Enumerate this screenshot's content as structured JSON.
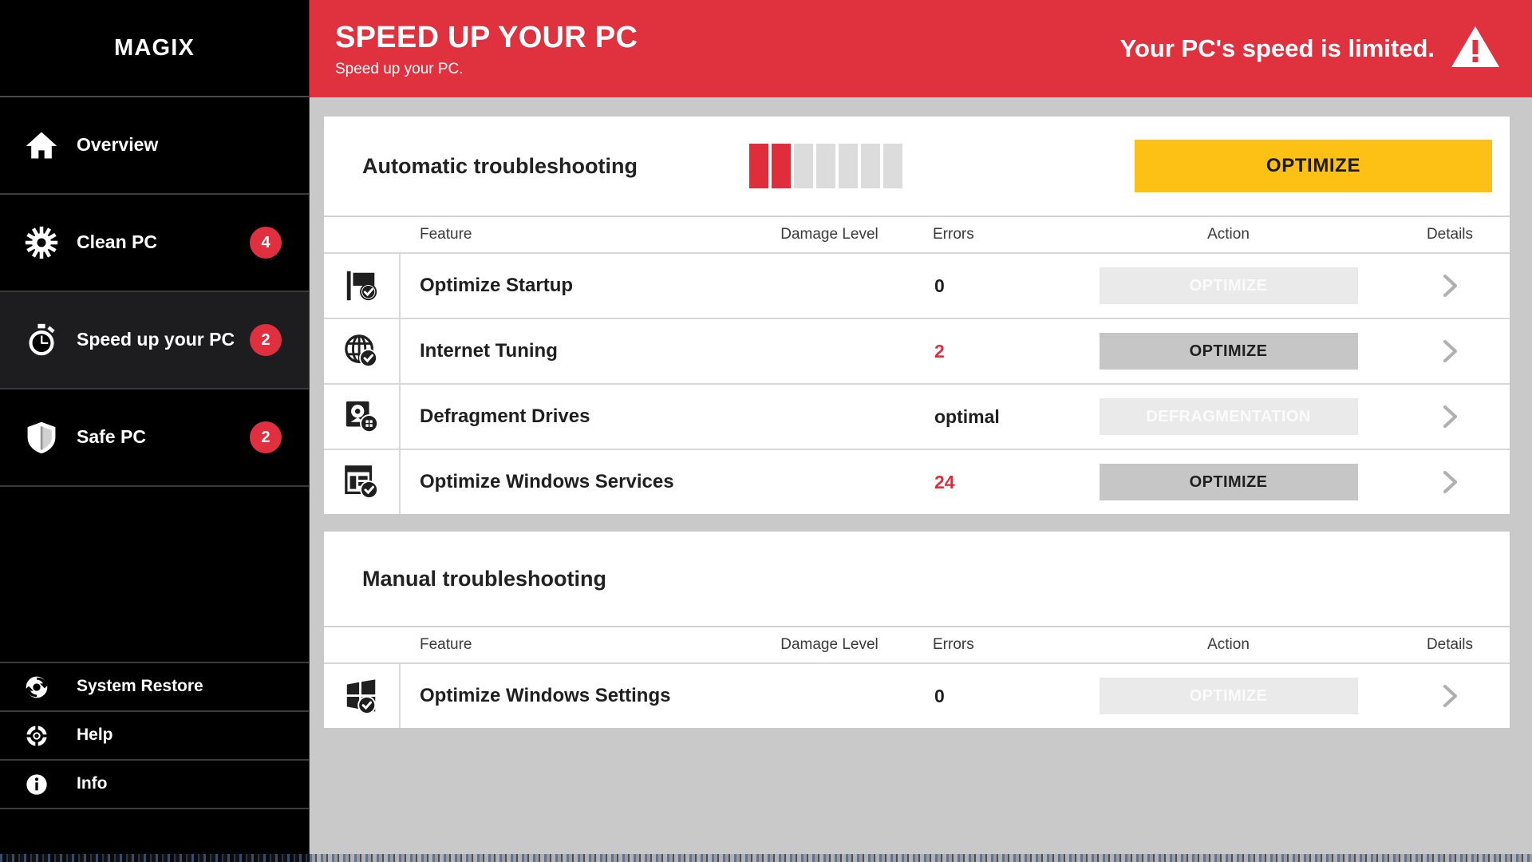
{
  "brand": {
    "name": "MAGIX"
  },
  "sidebar": {
    "main_items": [
      {
        "label": "Overview",
        "icon": "home-icon",
        "badge": null,
        "active": false
      },
      {
        "label": "Clean PC",
        "icon": "gear-icon",
        "badge": "4",
        "active": false
      },
      {
        "label": "Speed up your PC",
        "icon": "stopwatch-icon",
        "badge": "2",
        "active": true
      },
      {
        "label": "Safe PC",
        "icon": "shield-icon",
        "badge": "2",
        "active": false
      }
    ],
    "bottom_items": [
      {
        "label": "System Restore",
        "icon": "restore-icon"
      },
      {
        "label": "Help",
        "icon": "lifebuoy-icon"
      },
      {
        "label": "Info",
        "icon": "info-icon"
      }
    ]
  },
  "header": {
    "title": "SPEED UP YOUR PC",
    "subtitle": "Speed up your PC.",
    "status": "Your PC's speed is limited.",
    "status_icon": "warning-triangle-icon",
    "background_color": "#e0313f"
  },
  "automatic": {
    "title": "Automatic troubleshooting",
    "damage_level": [
      "red",
      "red",
      "gray",
      "gray",
      "gray",
      "gray",
      "gray"
    ],
    "optimize_label": "OPTIMIZE",
    "optimize_color": "#fdc014",
    "columns": {
      "feature": "Feature",
      "damage": "Damage Level",
      "errors": "Errors",
      "action": "Action",
      "details": "Details"
    },
    "rows": [
      {
        "icon": "flag-check-icon",
        "feature": "Optimize Startup",
        "damage_level": [
          "green",
          "green",
          "green",
          "green",
          "green",
          "green",
          "green"
        ],
        "errors": "0",
        "errors_alert": false,
        "action_label": "OPTIMIZE",
        "action_enabled": false,
        "details_icon": "chevron-right-icon"
      },
      {
        "icon": "globe-check-icon",
        "feature": "Internet Tuning",
        "damage_level": [
          "red",
          "gray",
          "gray",
          "gray",
          "gray",
          "gray",
          "gray"
        ],
        "errors": "2",
        "errors_alert": true,
        "action_label": "OPTIMIZE",
        "action_enabled": true,
        "details_icon": "chevron-right-icon"
      },
      {
        "icon": "disk-defrag-icon",
        "feature": "Defragment Drives",
        "damage_level": [
          "green",
          "green",
          "green",
          "green",
          "green",
          "green",
          "green"
        ],
        "errors": "optimal",
        "errors_alert": false,
        "action_label": "DEFRAGMENTATION",
        "action_enabled": false,
        "details_icon": "chevron-right-icon"
      },
      {
        "icon": "services-check-icon",
        "feature": "Optimize Windows Services",
        "damage_level": [
          "red",
          "red",
          "red",
          "red",
          "red",
          "red",
          "red"
        ],
        "errors": "24",
        "errors_alert": true,
        "action_label": "OPTIMIZE",
        "action_enabled": true,
        "details_icon": "chevron-right-icon"
      }
    ]
  },
  "manual": {
    "title": "Manual troubleshooting",
    "columns": {
      "feature": "Feature",
      "damage": "Damage Level",
      "errors": "Errors",
      "action": "Action",
      "details": "Details"
    },
    "rows": [
      {
        "icon": "windows-check-icon",
        "feature": "Optimize Windows Settings",
        "damage_level": [
          "green",
          "green",
          "green",
          "green",
          "green",
          "green",
          "green"
        ],
        "errors": "0",
        "errors_alert": false,
        "action_label": "OPTIMIZE",
        "action_enabled": false,
        "details_icon": "chevron-right-icon"
      }
    ]
  },
  "colors": {
    "accent_red": "#e0313f",
    "ok_green": "#36c98a",
    "warn_yellow": "#fdc014",
    "neutral_gray": "#dcdcdc",
    "sidebar_black": "#000000"
  }
}
